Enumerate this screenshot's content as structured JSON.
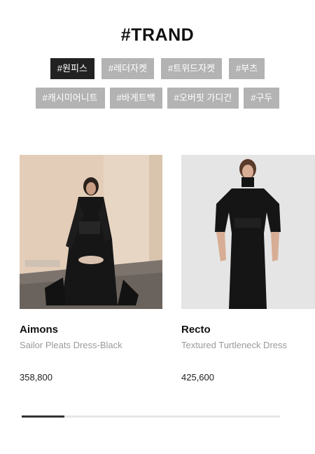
{
  "section": {
    "title": "#TRAND"
  },
  "tags_row1": [
    {
      "label": "#원피스",
      "active": true
    },
    {
      "label": "#레더자켓",
      "active": false
    },
    {
      "label": "#트위드자켓",
      "active": false
    },
    {
      "label": "#부츠",
      "active": false
    }
  ],
  "tags_row2": [
    {
      "label": "#캐시미어니트",
      "active": false
    },
    {
      "label": "#바게트백",
      "active": false
    },
    {
      "label": "#오버핏 가디건",
      "active": false
    },
    {
      "label": "#구두",
      "active": false
    }
  ],
  "products": [
    {
      "brand": "Aimons",
      "name": "Sailor Pleats Dress-Black",
      "price": "358,800"
    },
    {
      "brand": "Recto",
      "name": "Textured Turtleneck Dress",
      "price": "425,600"
    }
  ],
  "colors": {
    "active_tag": "#222222",
    "inactive_tag": "#b3b3b3",
    "scroll_thumb": "#333333"
  }
}
